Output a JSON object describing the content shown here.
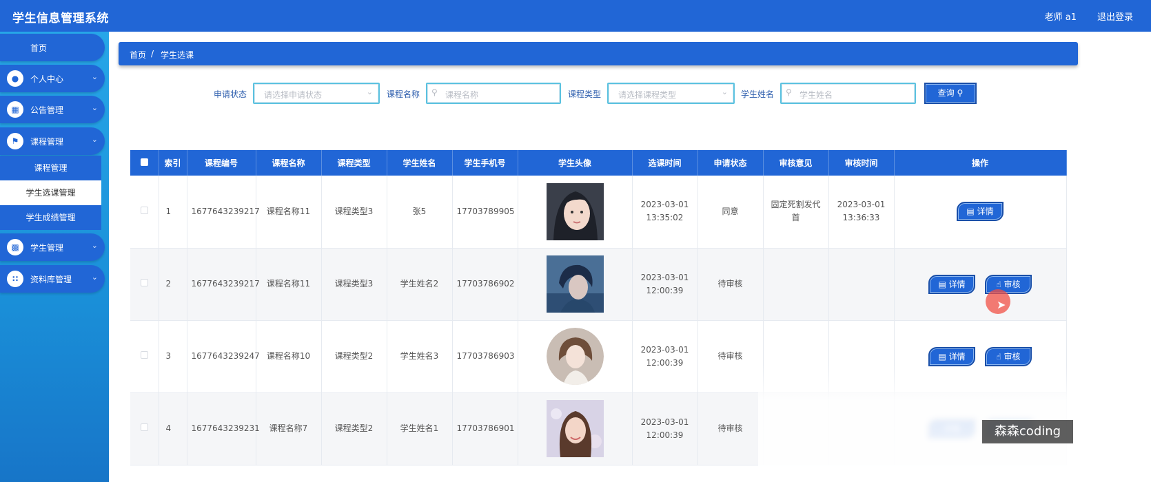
{
  "header": {
    "title": "学生信息管理系统",
    "user": "老师 a1",
    "logout": "退出登录"
  },
  "sidebar": {
    "home": "首页",
    "menus": [
      {
        "label": "个人中心",
        "icon": "user-icon"
      },
      {
        "label": "公告管理",
        "icon": "grid-icon"
      },
      {
        "label": "课程管理",
        "icon": "flag-icon"
      },
      {
        "label": "学生管理",
        "icon": "monitor-icon"
      },
      {
        "label": "资料库管理",
        "icon": "apps-icon"
      }
    ],
    "submenu": [
      "课程管理",
      "学生选课管理",
      "学生成绩管理"
    ]
  },
  "breadcrumb": {
    "home": "首页",
    "sep": "/",
    "current": "学生选课"
  },
  "filters": {
    "status_label": "申请状态",
    "status_placeholder": "请选择申请状态",
    "course_label": "课程名称",
    "course_placeholder": "课程名称",
    "type_label": "课程类型",
    "type_placeholder": "请选择课程类型",
    "student_label": "学生姓名",
    "student_placeholder": "学生姓名",
    "query": "查询"
  },
  "table": {
    "columns": [
      "索引",
      "课程编号",
      "课程名称",
      "课程类型",
      "学生姓名",
      "学生手机号",
      "学生头像",
      "选课时间",
      "申请状态",
      "审核意见",
      "审核时间",
      "操作"
    ],
    "rows": [
      {
        "index": "1",
        "code": "1677643239217",
        "course": "课程名称11",
        "type": "课程类型3",
        "student": "张5",
        "phone": "17703789905",
        "time": "2023-03-01 13:35:02",
        "status": "同意",
        "opinion": "固定死割发代首",
        "review_time": "2023-03-01 13:36:33"
      },
      {
        "index": "2",
        "code": "1677643239217",
        "course": "课程名称11",
        "type": "课程类型3",
        "student": "学生姓名2",
        "phone": "17703786902",
        "time": "2023-03-01 12:00:39",
        "status": "待审核",
        "opinion": "",
        "review_time": ""
      },
      {
        "index": "3",
        "code": "1677643239247",
        "course": "课程名称10",
        "type": "课程类型2",
        "student": "学生姓名3",
        "phone": "17703786903",
        "time": "2023-03-01 12:00:39",
        "status": "待审核",
        "opinion": "",
        "review_time": ""
      },
      {
        "index": "4",
        "code": "1677643239231",
        "course": "课程名称7",
        "type": "课程类型2",
        "student": "学生姓名1",
        "phone": "17703786901",
        "time": "2023-03-01 12:00:39",
        "status": "待审核",
        "opinion": "",
        "review_time": ""
      }
    ],
    "detail_btn": "详情",
    "review_btn": "审核"
  },
  "watermark": "森森coding",
  "colors": {
    "primary": "#2166d6",
    "sidebar": "#1a8fd8",
    "input_border": "#5bc2e0"
  }
}
